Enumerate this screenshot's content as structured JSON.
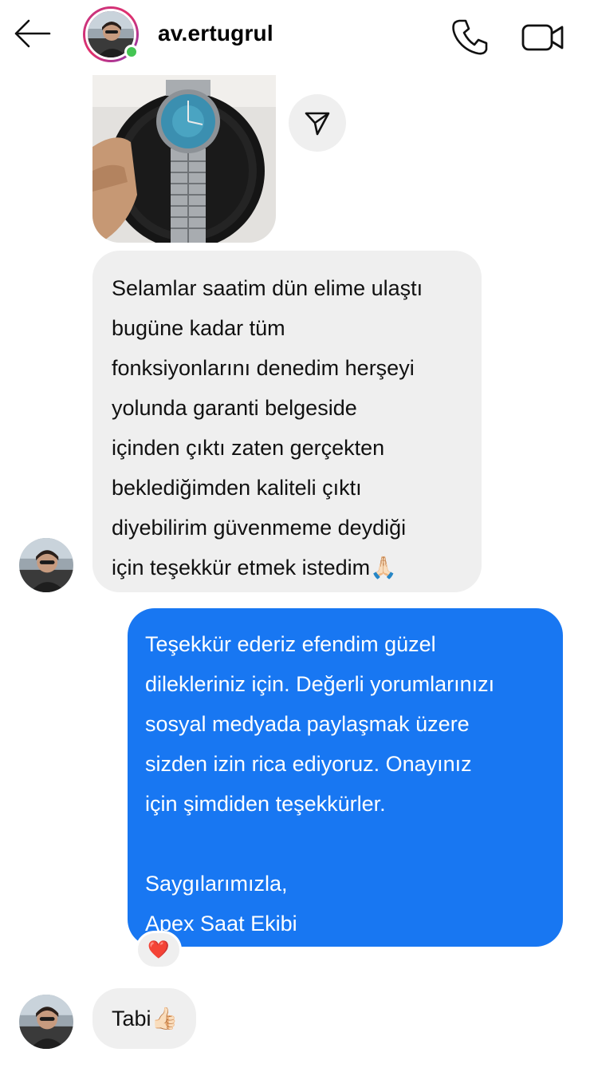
{
  "header": {
    "username": "av.ertugrul",
    "back_icon": "arrow-left-icon",
    "call_icon": "phone-icon",
    "video_icon": "video-camera-icon",
    "online": true,
    "online_color": "#44c553"
  },
  "messages": {
    "incoming_photo": {
      "subject": "wristwatch with blue dial in gift tin",
      "share_icon": "send-icon"
    },
    "incoming_1": {
      "lines": [
        "Selamlar saatim dün elime ulaştı",
        "bugüne kadar tüm",
        "fonksiyonlarını denedim herşeyi",
        "yolunda garanti belgeside",
        "içinden çıktı zaten gerçekten",
        "beklediğimden kaliteli çıktı",
        "diyebilirim güvenmeme deydiği",
        "için teşekkür etmek istedim🙏🏻"
      ]
    },
    "outgoing_1": {
      "lines": [
        "Teşekkür ederiz efendim güzel",
        "dilekleriniz için. Değerli yorumlarınızı",
        "sosyal medyada paylaşmak üzere",
        "sizden izin rica ediyoruz. Onayınız",
        "için şimdiden teşekkürler."
      ],
      "signoff": [
        "Saygılarımızla,",
        "Apex Saat Ekibi"
      ],
      "reaction": "❤️",
      "bubble_color": "#1877f2"
    },
    "incoming_2": {
      "text": "Tabi👍🏻"
    }
  },
  "colors": {
    "incoming_bubble": "#efefef",
    "outgoing_bubble": "#1877f2"
  }
}
